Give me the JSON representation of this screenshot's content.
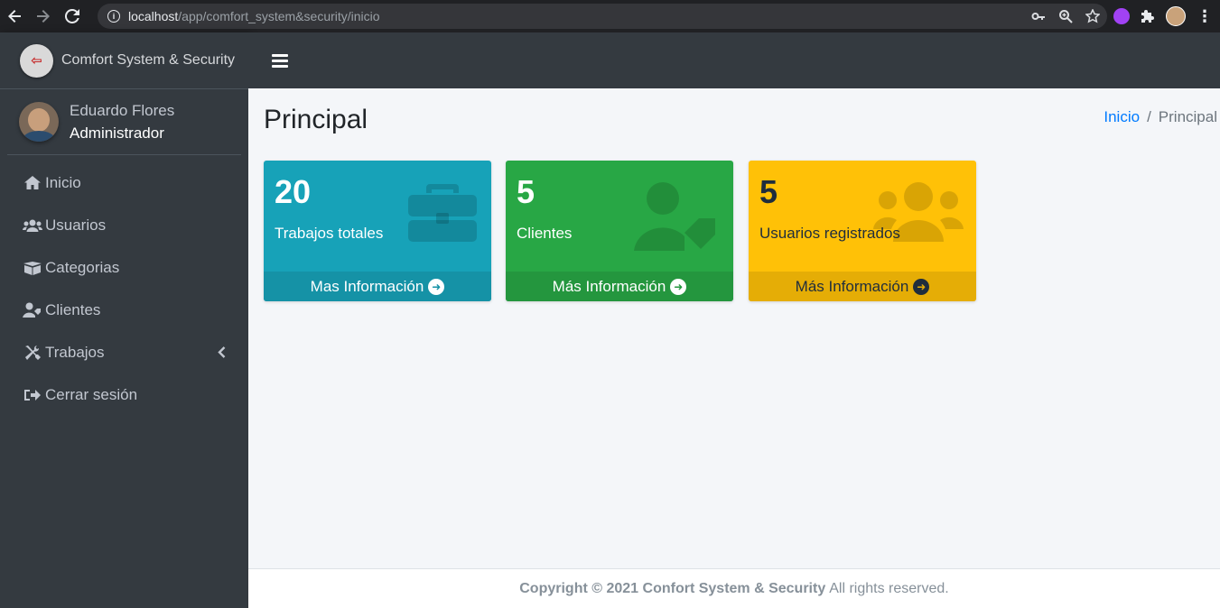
{
  "browser": {
    "url_host": "localhost",
    "url_path": "/app/comfort_system&security/inicio"
  },
  "brand": {
    "name": "Comfort System & Security"
  },
  "user": {
    "name": "Eduardo Flores",
    "role": "Administrador"
  },
  "menu": [
    {
      "label": "Inicio",
      "icon": "home-icon"
    },
    {
      "label": "Usuarios",
      "icon": "users-icon"
    },
    {
      "label": "Categorias",
      "icon": "boxes-icon"
    },
    {
      "label": "Clientes",
      "icon": "user-tag-icon"
    },
    {
      "label": "Trabajos",
      "icon": "tools-icon"
    },
    {
      "label": "Cerrar sesión",
      "icon": "sign-out-icon"
    }
  ],
  "page": {
    "title": "Principal",
    "breadcrumb": {
      "home": "Inicio",
      "separator": "/",
      "current": "Principal"
    }
  },
  "cards": [
    {
      "number": "20",
      "label": "Trabajos totales",
      "footer": "Mas Información",
      "color": "#17a2b8",
      "icon": "briefcase-icon"
    },
    {
      "number": "5",
      "label": "Clientes",
      "footer": "Más Información",
      "color": "#28a745",
      "icon": "user-tag-icon"
    },
    {
      "number": "5",
      "label": "Usuarios registrados",
      "footer": "Más Información",
      "color": "#ffc107",
      "icon": "users-icon"
    }
  ],
  "footer": {
    "copyright": "Copyright © 2021 Confort System & Security",
    "rights": "All rights reserved."
  }
}
